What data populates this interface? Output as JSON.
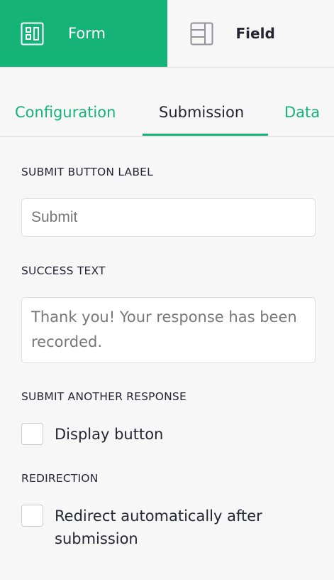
{
  "top_tabs": [
    {
      "label": "Form",
      "icon": "form-layout-icon"
    },
    {
      "label": "Field",
      "icon": "field-layout-icon"
    }
  ],
  "sub_tabs": [
    {
      "label": "Configuration"
    },
    {
      "label": "Submission"
    },
    {
      "label": "Data"
    }
  ],
  "submission": {
    "submit_label_heading": "SUBMIT BUTTON LABEL",
    "submit_label_placeholder": "Submit",
    "success_heading": "SUCCESS TEXT",
    "success_placeholder": "Thank you! Your response has been recorded.",
    "another_heading": "SUBMIT ANOTHER RESPONSE",
    "display_button_label": "Display button",
    "redirection_heading": "REDIRECTION",
    "redirect_label": "Redirect automatically after submission"
  },
  "colors": {
    "accent": "#16b378"
  }
}
